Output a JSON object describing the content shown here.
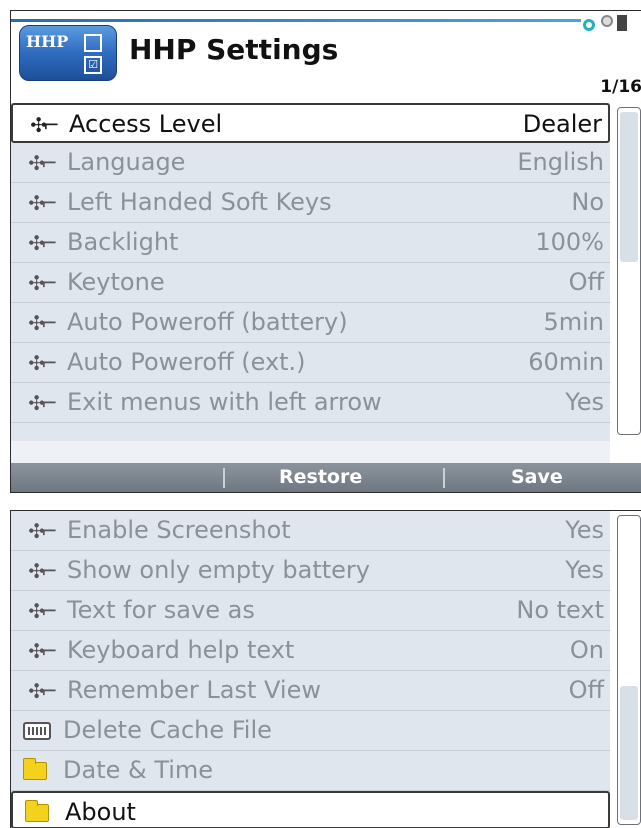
{
  "app": {
    "title": "HHP Settings",
    "logo_text": "HHP",
    "page_indicator": "1/16"
  },
  "colors": {
    "accent": "#2a6ab8",
    "list_background": "#dfe6ed",
    "softkey_bar": "#7a838c",
    "folder": "#f4d11c"
  },
  "screen1": {
    "items": [
      {
        "label": "Access Level",
        "value": "Dealer",
        "icon": "wrench-icon",
        "selected": true
      },
      {
        "label": "Language",
        "value": "English",
        "icon": "wrench-icon"
      },
      {
        "label": "Left Handed Soft Keys",
        "value": "No",
        "icon": "wrench-icon"
      },
      {
        "label": "Backlight",
        "value": "100%",
        "icon": "wrench-icon"
      },
      {
        "label": "Keytone",
        "value": "Off",
        "icon": "wrench-icon"
      },
      {
        "label": "Auto Poweroff (battery)",
        "value": "5min",
        "icon": "wrench-icon"
      },
      {
        "label": "Auto Poweroff (ext.)",
        "value": "60min",
        "icon": "wrench-icon"
      },
      {
        "label": "Exit menus with left arrow",
        "value": "Yes",
        "icon": "wrench-icon"
      }
    ],
    "softkeys": {
      "restore_label": "Restore",
      "save_label": "Save"
    }
  },
  "screen2": {
    "items": [
      {
        "label": "Enable Screenshot",
        "value": "Yes",
        "icon": "wrench-icon"
      },
      {
        "label": "Show only empty battery",
        "value": "Yes",
        "icon": "wrench-icon"
      },
      {
        "label": "Text for save as",
        "value": "No text",
        "icon": "wrench-icon"
      },
      {
        "label": "Keyboard help text",
        "value": "On",
        "icon": "wrench-icon"
      },
      {
        "label": "Remember Last View",
        "value": "Off",
        "icon": "wrench-icon"
      },
      {
        "label": "Delete Cache File",
        "value": "",
        "icon": "keyboard-icon"
      },
      {
        "label": "Date & Time",
        "value": "",
        "icon": "folder-icon"
      },
      {
        "label": "About",
        "value": "",
        "icon": "folder-icon",
        "selected": true
      }
    ]
  }
}
